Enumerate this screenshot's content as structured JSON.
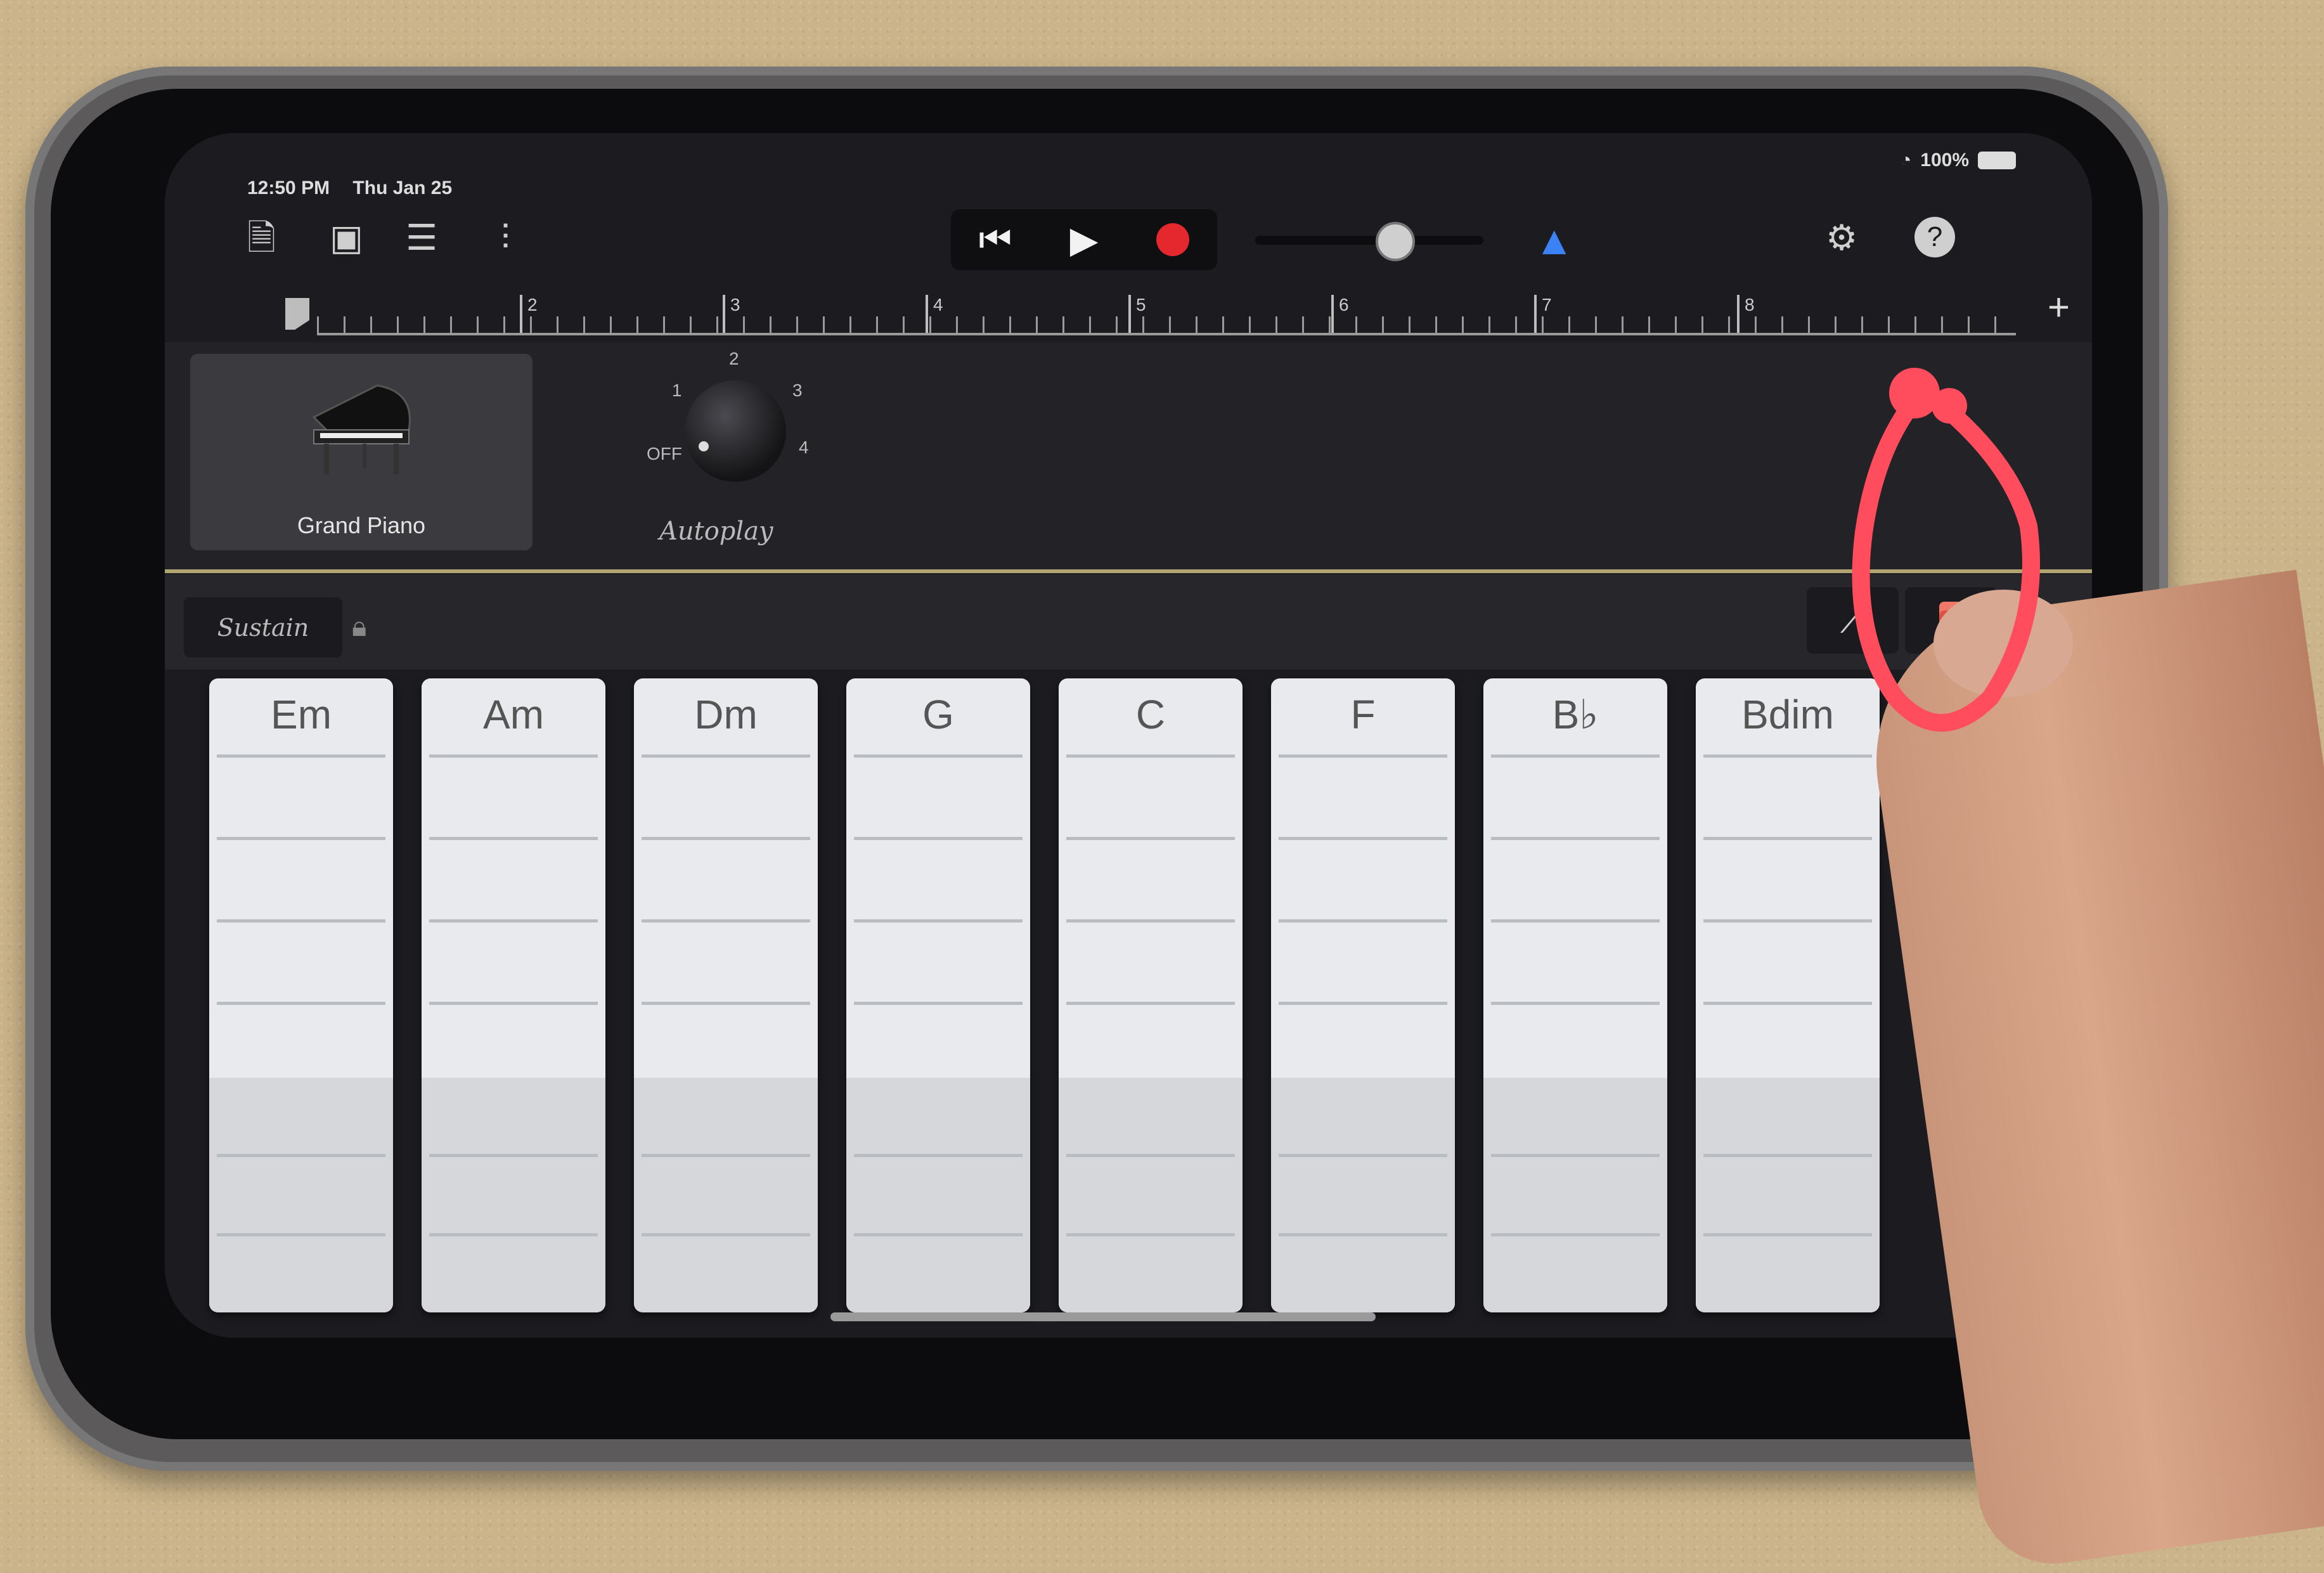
{
  "status_bar": {
    "time": "12:50 PM",
    "date": "Thu Jan 25",
    "battery": "100%"
  },
  "toolbar": {
    "icons": [
      "document-icon",
      "tracks-view-icon",
      "track-list-icon",
      "mixer-icon",
      "rewind-icon",
      "play-icon",
      "record-icon",
      "metronome-icon",
      "settings-icon",
      "help-icon"
    ],
    "help_glyph": "?"
  },
  "ruler": {
    "bars": [
      "2",
      "3",
      "4",
      "5",
      "6",
      "7",
      "8"
    ],
    "add_glyph": "+"
  },
  "instrument": {
    "name": "Grand Piano",
    "autoplay_label": "Autoplay",
    "autoplay_positions": [
      "OFF",
      "1",
      "2",
      "3",
      "4"
    ]
  },
  "controls": {
    "sustain_label": "Sustain"
  },
  "chord_strips": {
    "labels": [
      "Em",
      "Am",
      "Dm",
      "G",
      "C",
      "F",
      "B♭",
      "Bdim"
    ]
  },
  "colors": {
    "record": "#e5282e",
    "metronome": "#3a82f5",
    "annotation": "#ff4d5e"
  }
}
